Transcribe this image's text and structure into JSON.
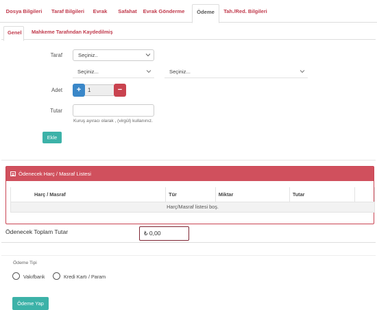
{
  "tabs": [
    "Dosya Bilgileri",
    "Taraf Bilgileri",
    "Evrak",
    "Safahat",
    "Evrak Gönderme",
    "Ödeme",
    "Tah./Red. Bilgileri"
  ],
  "subtabs": [
    "Genel",
    "Mahkeme Tarafından Kaydedilmiş"
  ],
  "form": {
    "taraf_label": "Taraf",
    "taraf_select": "Seçiniz..",
    "select_left": "Seçiniz...",
    "select_right": "Seçiniz...",
    "adet_label": "Adet",
    "adet_value": "1",
    "plus": "+",
    "minus": "−",
    "tutar_label": "Tutar",
    "help_text": "Kuruş ayıracı olarak , (virgül) kullanınız.",
    "ekle_button": "Ekle"
  },
  "panel": {
    "title": "Ödenecek Harç / Masraf Listesi",
    "columns": [
      "Harç / Masraf",
      "Tür",
      "Miktar",
      "Tutar"
    ],
    "empty_message": "Harç/Masraf listesi boş."
  },
  "total": {
    "label": "Ödenecek Toplam Tutar",
    "value": "₺ 0,00"
  },
  "payment": {
    "type_label": "Ödeme Tipi",
    "options": [
      "Vakıfbank",
      "Kredi Kartı / Param"
    ],
    "pay_button": "Ödeme Yap"
  },
  "colors": {
    "accent_red": "#d0505d",
    "teal": "#3cb2a8",
    "blue": "#3a87c8",
    "tab_red": "#c0394b"
  }
}
